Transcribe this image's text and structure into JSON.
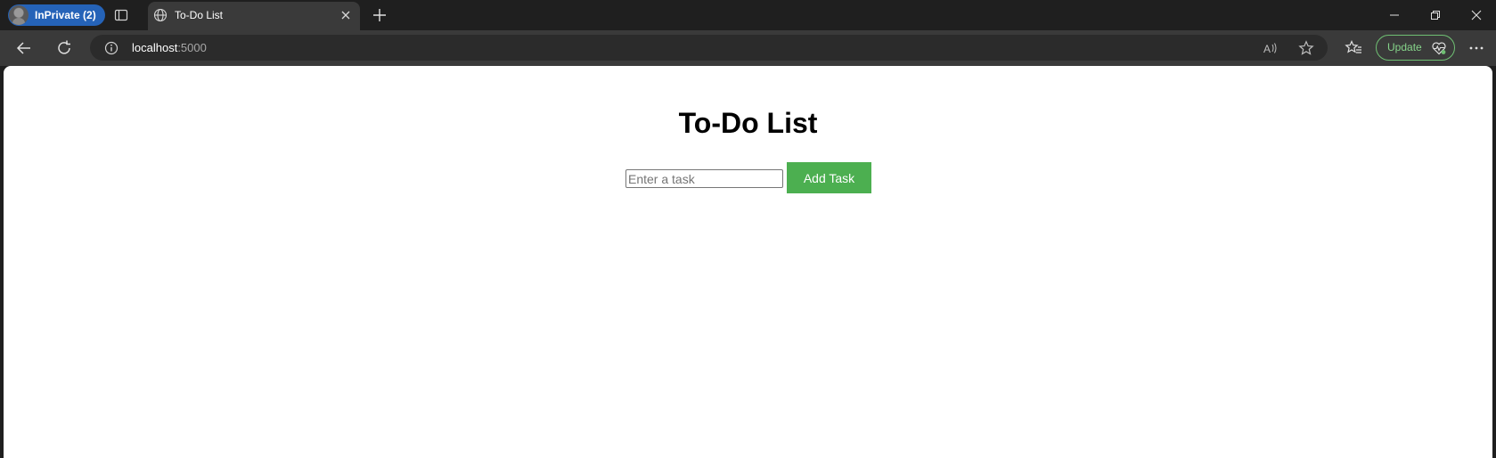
{
  "tabstrip": {
    "profile_label": "InPrivate (2)",
    "tab_title": "To-Do List"
  },
  "toolbar": {
    "url_host": "localhost",
    "url_port": ":5000",
    "update_label": "Update"
  },
  "page": {
    "title": "To-Do List",
    "input_placeholder": "Enter a task",
    "input_value": "",
    "add_button_label": "Add Task"
  },
  "colors": {
    "profile_pill": "#2563b8",
    "add_button": "#4caf50",
    "update_accent": "#6fbf73"
  },
  "icons": [
    "avatar",
    "tab-actions-icon",
    "globe-icon",
    "close-icon",
    "plus-icon",
    "minimize-icon",
    "restore-icon",
    "window-close-icon",
    "back-arrow-icon",
    "reload-icon",
    "info-icon",
    "read-aloud-icon",
    "star-icon",
    "favorites-icon",
    "heart-pulse-icon",
    "more-icon"
  ]
}
